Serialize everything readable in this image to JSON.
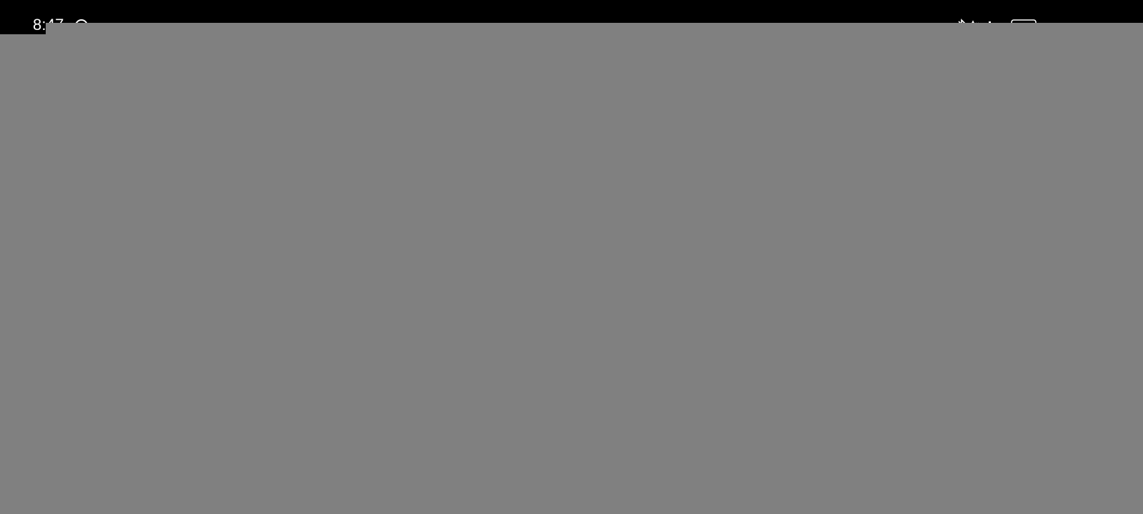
{
  "status_bar": {
    "time": "8:47",
    "icons": [
      "notification-icon",
      "bluetooth-icon",
      "data-4g-icon",
      "signal-icon",
      "wifi-icon",
      "battery-icon"
    ]
  },
  "colors": {
    "status_bar_bg": "#000000",
    "status_text": "#ffffff",
    "overlay": "#808080"
  }
}
